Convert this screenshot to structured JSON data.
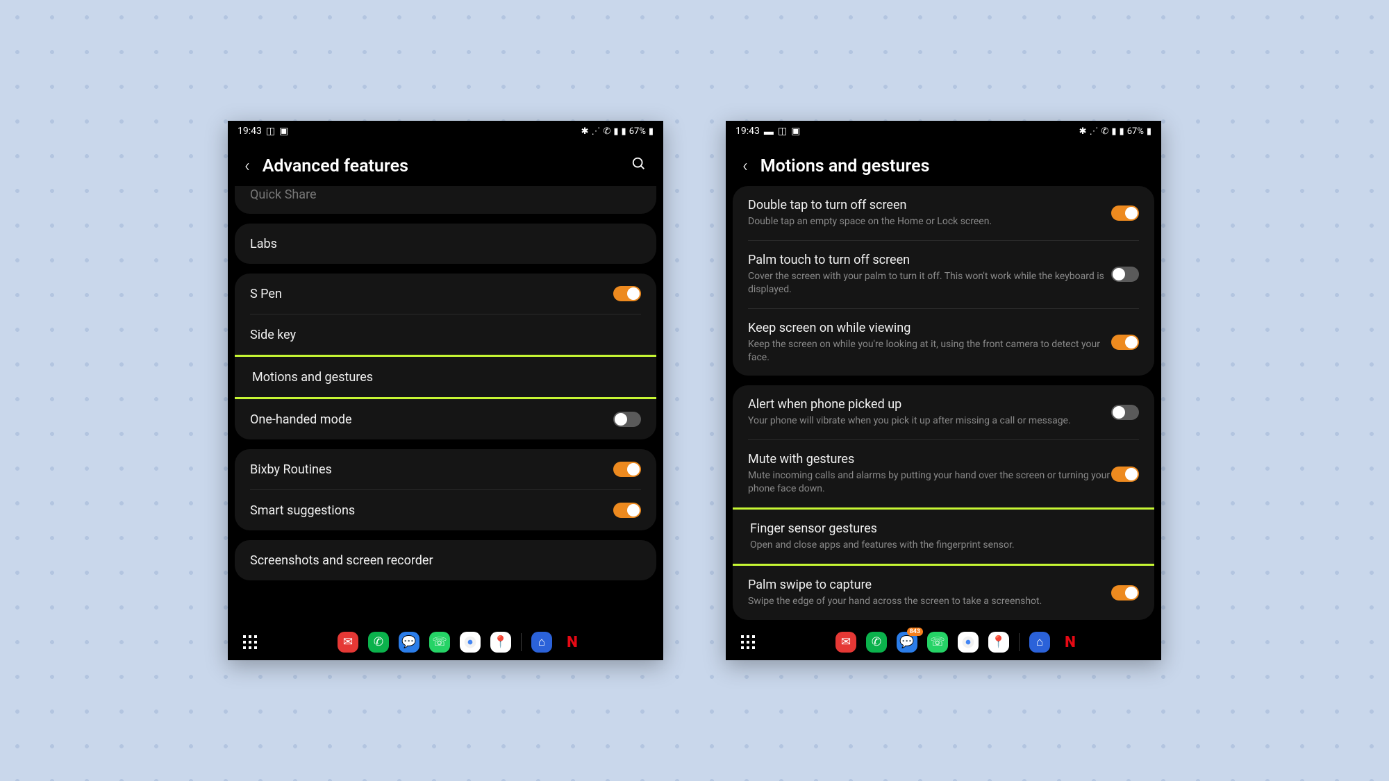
{
  "status": {
    "time": "19:43",
    "battery": "67%"
  },
  "left_screen": {
    "title": "Advanced features",
    "rows": {
      "quick_share": "Quick Share",
      "labs": "Labs",
      "s_pen": "S Pen",
      "side_key": "Side key",
      "motions": "Motions and gestures",
      "one_handed": "One-handed mode",
      "bixby": "Bixby Routines",
      "smart": "Smart suggestions",
      "screenshots": "Screenshots and screen recorder"
    }
  },
  "right_screen": {
    "title": "Motions and gestures",
    "items": {
      "double_tap": {
        "title": "Double tap to turn off screen",
        "sub": "Double tap an empty space on the Home or Lock screen."
      },
      "palm_touch": {
        "title": "Palm touch to turn off screen",
        "sub": "Cover the screen with your palm to turn it off. This won't work while the keyboard is displayed."
      },
      "keep_screen": {
        "title": "Keep screen on while viewing",
        "sub": "Keep the screen on while you're looking at it, using the front camera to detect your face."
      },
      "alert": {
        "title": "Alert when phone picked up",
        "sub": "Your phone will vibrate when you pick it up after missing a call or message."
      },
      "mute": {
        "title": "Mute with gestures",
        "sub": "Mute incoming calls and alarms by putting your hand over the screen or turning your phone face down."
      },
      "finger": {
        "title": "Finger sensor gestures",
        "sub": "Open and close apps and features with the fingerprint sensor."
      },
      "palm_swipe": {
        "title": "Palm swipe to capture",
        "sub": "Swipe the edge of your hand across the screen to take a screenshot."
      }
    }
  },
  "nav": {
    "badge": "843",
    "netflix": "N"
  }
}
